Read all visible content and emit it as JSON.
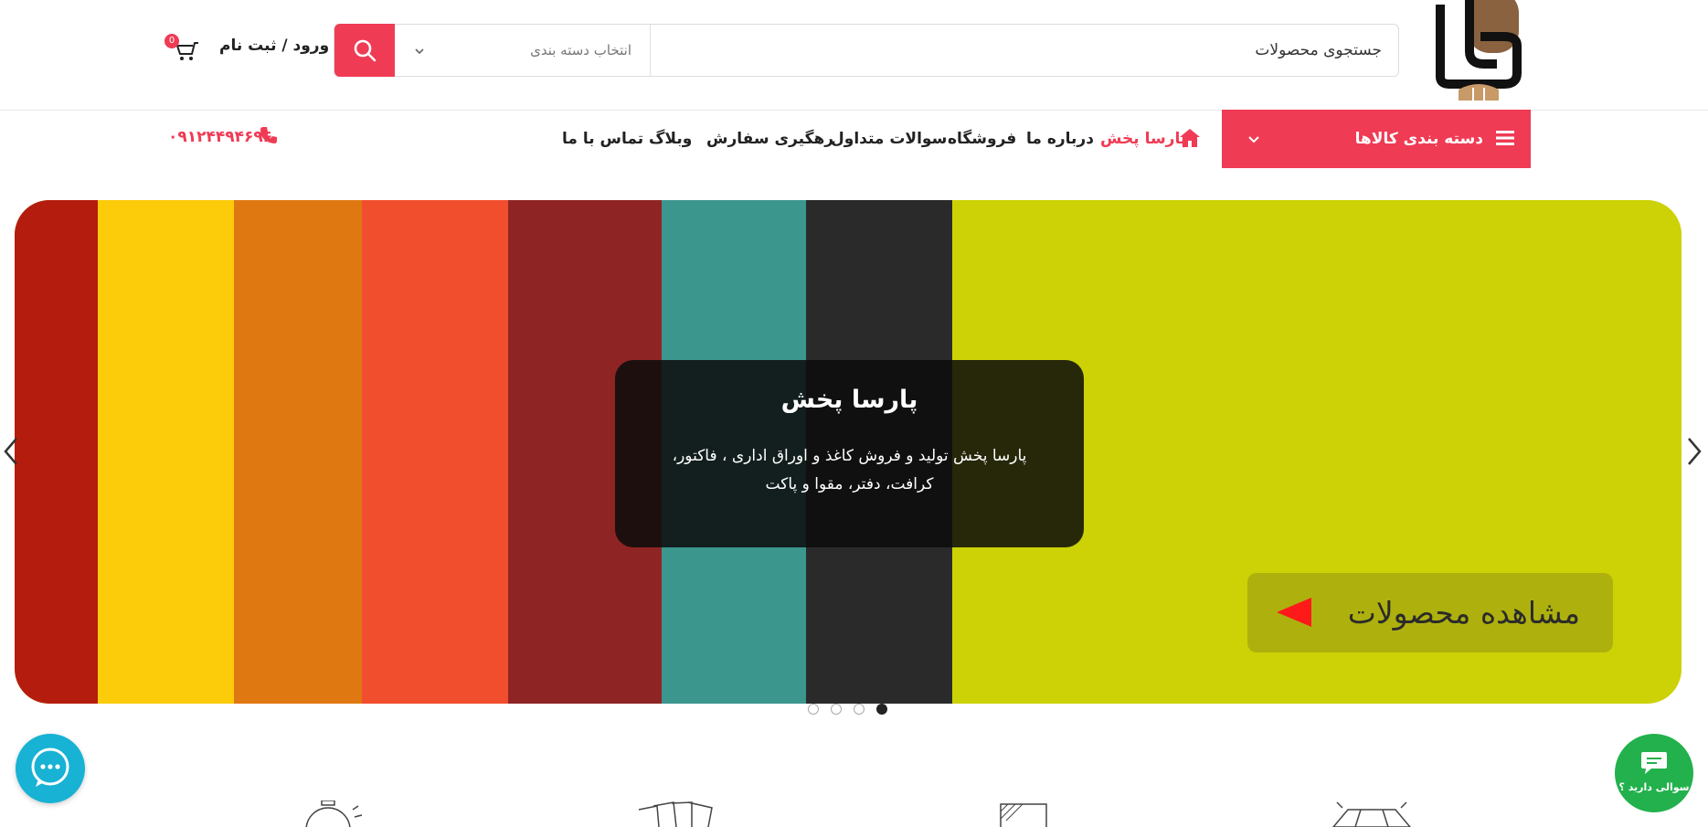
{
  "header": {
    "search_placeholder": "جستجوی محصولات",
    "category_select": "انتخاب دسته بندی",
    "login_label": "ورود / ثبت نام",
    "cart_count": "0"
  },
  "nav": {
    "categories_label": "دسته بندی کالاها",
    "items": [
      "پارسا پخش",
      "درباره ما",
      "فروشگاه",
      "سوالات متداول",
      "رهگیری سفارش",
      "وبلاگ",
      "تماس با ما"
    ],
    "phone": "۰۹۱۲۴۴۹۴۶۹۶"
  },
  "hero": {
    "title": "پارسا پخش",
    "description": "پارسا پخش تولید و فروش کاغذ و اوراق اداری ، فاکتور، کرافت، دفتر، مقوا و پاکت",
    "cta_label": "مشاهده محصولات",
    "slide_count": 4,
    "active_slide": 4
  },
  "floating": {
    "question_label": "سوالی دارید ؟"
  },
  "colors": {
    "accent": "#ef3b54",
    "chat": "#17b2d4",
    "question": "#22b14c"
  }
}
